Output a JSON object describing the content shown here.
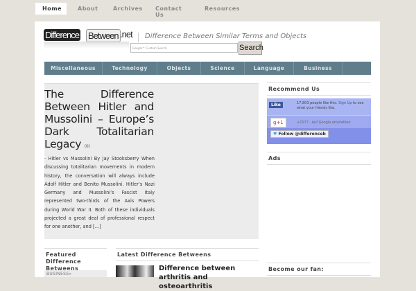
{
  "top_nav": [
    "Home",
    "About",
    "Archives",
    "Contact Us",
    "Resources"
  ],
  "logo": {
    "part1": "Difference",
    "part2": "Between",
    "part3": ".net"
  },
  "tagline": "Difference Between Similar Terms and Objects",
  "search": {
    "placeholder": "Google™ Custom Search",
    "button": "Search"
  },
  "categories": [
    "Miscellaneous",
    "Technology",
    "Objects",
    "Science",
    "Language",
    "Business"
  ],
  "featured": {
    "title": "The Difference Between Hitler and Mussolini – Europe’s Dark Totalitarian Legacy",
    "comments": "(0)",
    "excerpt": "· Hitler vs Mussolini By Jay Stooksberry When discussing totalitarian movements in modern history, the conversation will always include Adolf Hitler and Benito Mussolini. Hitler’s Nazi Germany and Mussolini’s Fascist Italy represented two-thirds of the Axis Powers during World War II. Both of these individuals projected a great deal of professional respect for one another, and […]"
  },
  "sidebar": {
    "recommend_heading": "Recommend Us",
    "fb_like": "Like",
    "fb_text": "17,803 people like this.",
    "fb_signup": "Sign Up",
    "fb_text2": "to see what your friends like.",
    "gplus": "g+1",
    "gplus_text": "+1577 · Auf Google empfehlen",
    "twitter": "Follow @differenceb",
    "ads_heading": "Ads",
    "fan_heading": "Become our fan:"
  },
  "featured_col": {
    "heading": "Featured Difference Betweens",
    "item": "BUSINESS»"
  },
  "latest": {
    "heading": "Latest Difference Betweens",
    "item_title": "Difference between arthritis and osteoarthritis"
  }
}
